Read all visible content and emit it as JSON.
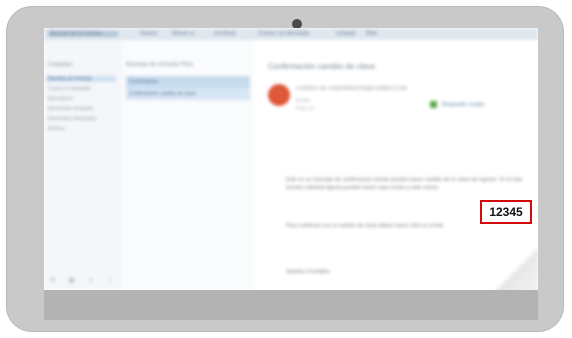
{
  "email": {
    "subject": "Confirmación cambio de clave",
    "sender": "CORREO DE CONFIRMACION@CORREO.COM",
    "date": "Fecha",
    "recipient": "Para: tú",
    "reply_label": "Responder a todos",
    "body_paragraph_1": "Este es un mensaje de confirmación donde puedes hacer cambio de tu clave de ingreso. Si no has hechos solicitud alguna puedes hacer caso omiso a este correo.",
    "body_paragraph_2": "Para continuar con el cambio de clave debes hacer click en el link",
    "closing": "Saludos Cordiales",
    "code": "12345"
  },
  "nav": {
    "items": [
      "Buscar en el correo",
      "Nuevo",
      "Mover a",
      "Archivar",
      "Correo no deseado",
      "Limpiar",
      "Más"
    ]
  },
  "folders": {
    "header": "Carpetas",
    "items": [
      "Bandeja de entrada",
      "Correo no deseado",
      "Borradores",
      "Elementos enviados",
      "Elementos eliminados",
      "Archivo"
    ]
  },
  "list": {
    "header": "Bandeja de entrada   Filtro",
    "rows": [
      "Confirmación",
      "Confirmación cambio de clave"
    ]
  },
  "colors": {
    "accent_red": "#d20a0a",
    "avatar": "#e0583a",
    "selection": "#c7dcef"
  }
}
